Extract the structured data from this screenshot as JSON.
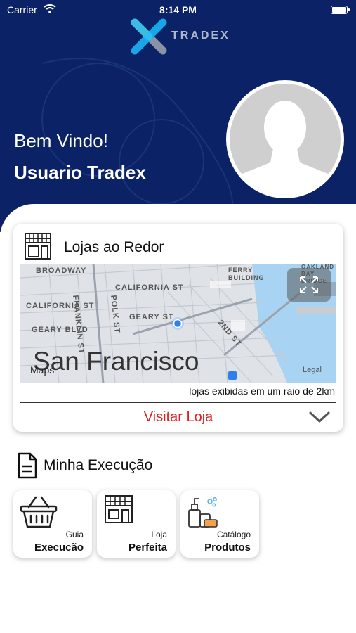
{
  "status_bar": {
    "carrier": "Carrier",
    "time": "8:14 PM"
  },
  "brand": {
    "name": "TRADEX"
  },
  "header": {
    "welcome": "Bem Vindo!",
    "username": "Usuario Tradex"
  },
  "colors": {
    "header_bg": "#0b2266",
    "accent_red": "#e02020",
    "logo_blue": "#19a6e8",
    "logo_gray": "#8a93a5"
  },
  "stores_card": {
    "title": "Lojas ao Redor",
    "icon": "storefront-icon",
    "map": {
      "city": "San Francisco",
      "attribution": "Maps",
      "legal": "Legal",
      "street_labels": [
        "BROADWAY",
        "CALIFORNIA ST",
        "CALIFORNIA ST",
        "GEARY BLVD",
        "GEARY ST",
        "FRANKLIN ST",
        "POLK ST",
        "2ND ST",
        "FERRY BUILDING",
        "OAKLAND BAY BRIDGE"
      ],
      "expand_icon": "expand-icon"
    },
    "radius_note": "lojas exibidas em um raio de 2km",
    "visit_label": "Visitar Loja",
    "toggle_icon": "chevron-down-icon"
  },
  "execution": {
    "title": "Minha Execução",
    "icon": "document-icon",
    "tiles": [
      {
        "small": "Guia",
        "big": "Execucão",
        "icon": "basket-icon"
      },
      {
        "small": "Loja",
        "big": "Perfeita",
        "icon": "store-icon"
      },
      {
        "small": "Catálogo",
        "big": "Produtos",
        "icon": "products-icon"
      }
    ]
  }
}
